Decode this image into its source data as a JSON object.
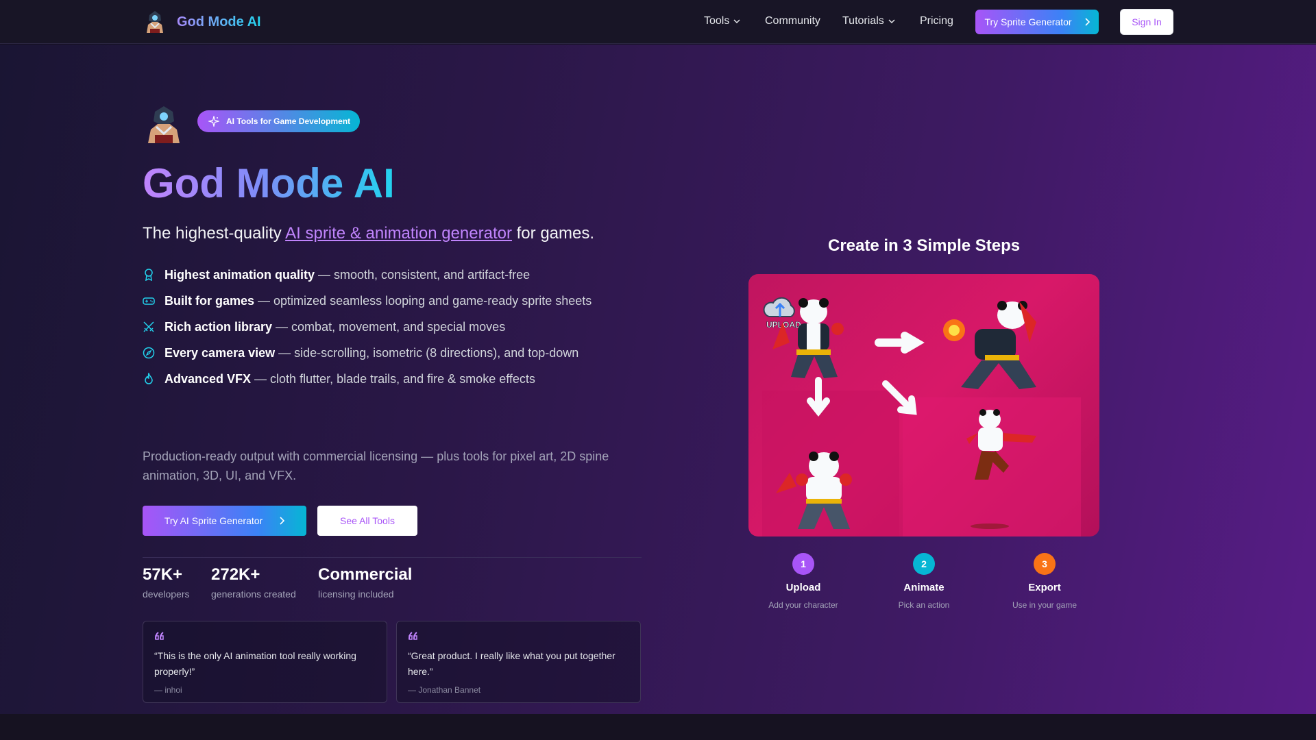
{
  "nav": {
    "brand": "God Mode AI",
    "links": [
      {
        "label": "Tools",
        "has_dropdown": true
      },
      {
        "label": "Community",
        "has_dropdown": false
      },
      {
        "label": "Tutorials",
        "has_dropdown": true
      },
      {
        "label": "Pricing",
        "has_dropdown": false
      }
    ],
    "cta_label": "Try Sprite Generator",
    "signin_label": "Sign In"
  },
  "hero": {
    "badge": "AI Tools for Game Development",
    "title": "God Mode AI",
    "subtitle_pre": "The highest-quality ",
    "subtitle_link": "AI sprite & animation generator",
    "subtitle_post": " for games.",
    "features": [
      {
        "icon": "award-icon",
        "bold": "Highest animation quality",
        "text": "— smooth, consistent, and artifact-free"
      },
      {
        "icon": "gamepad-icon",
        "bold": "Built for games",
        "text": "— optimized seamless looping and game-ready sprite sheets"
      },
      {
        "icon": "swords-icon",
        "bold": "Rich action library",
        "text": "— combat, movement, and special moves"
      },
      {
        "icon": "compass-icon",
        "bold": "Every camera view",
        "text": "— side-scrolling, isometric (8 directions), and top-down"
      },
      {
        "icon": "flame-icon",
        "bold": "Advanced VFX",
        "text": "— cloth flutter, blade trails, and fire & smoke effects"
      }
    ],
    "description": "Production-ready output with commercial licensing — plus tools for pixel art, 2D spine animation, 3D, UI, and VFX.",
    "primary_button": "Try AI Sprite Generator",
    "secondary_button": "See All Tools",
    "stats": [
      {
        "value": "57K+",
        "label": "developers"
      },
      {
        "value": "272K+",
        "label": "generations created"
      },
      {
        "value": "Commercial",
        "label": "licensing included"
      }
    ],
    "testimonials": [
      {
        "text": "“This is the only AI animation tool really working properly!”",
        "author": "— inhoi"
      },
      {
        "text": "“Great product. I really like what you put together here.”",
        "author": "— Jonathan Bannet"
      }
    ]
  },
  "steps_panel": {
    "title": "Create in 3 Simple Steps",
    "image_label": "UPLOAD",
    "steps": [
      {
        "num": "1",
        "title": "Upload",
        "sub": "Add your character",
        "color": "#a855f7"
      },
      {
        "num": "2",
        "title": "Animate",
        "sub": "Pick an action",
        "color": "#06b6d4"
      },
      {
        "num": "3",
        "title": "Export",
        "sub": "Use in your game",
        "color": "#f97316"
      }
    ]
  },
  "colors": {
    "accent_purple": "#a855f7",
    "accent_cyan": "#06b6d4",
    "panel_pink": "#d81868"
  }
}
